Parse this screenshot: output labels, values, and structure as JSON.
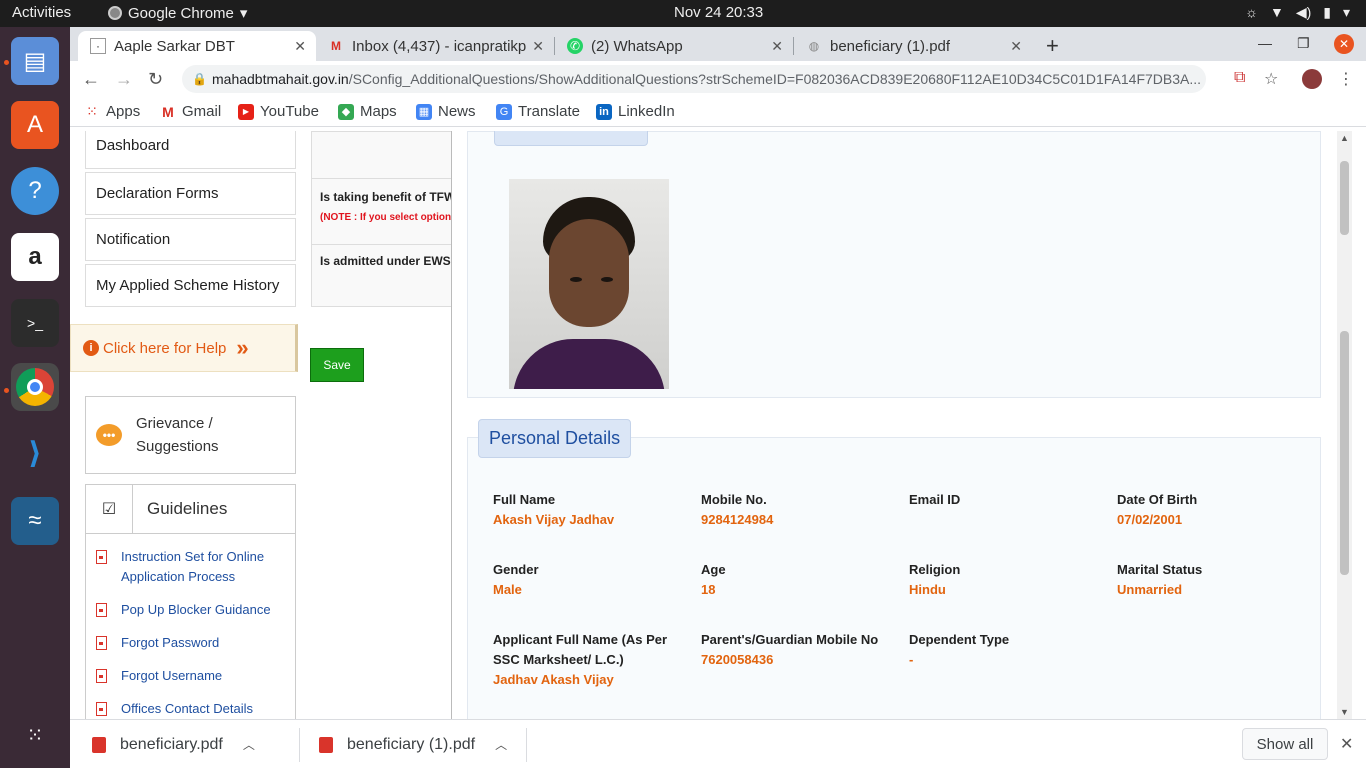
{
  "topbar": {
    "activities": "Activities",
    "app": "Google Chrome",
    "clock": "Nov 24  20:33"
  },
  "tabs": [
    {
      "title": "Aaple Sarkar DBT",
      "active": true
    },
    {
      "title": "Inbox (4,437) - icanpratikp",
      "active": false
    },
    {
      "title": "(2) WhatsApp",
      "active": false
    },
    {
      "title": "beneficiary (1).pdf",
      "active": false
    }
  ],
  "address": {
    "domain": "mahadbtmahait.gov.in",
    "path": "/SConfig_AdditionalQuestions/ShowAdditionalQuestions?strSchemeID=F082036ACD839E20680F112AE10D34C5C01D1FA14F7DB3A..."
  },
  "bookmarks": [
    {
      "label": "Apps",
      "icon": "apps-grid-icon"
    },
    {
      "label": "Gmail",
      "icon": "gmail-icon"
    },
    {
      "label": "YouTube",
      "icon": "youtube-icon"
    },
    {
      "label": "Maps",
      "icon": "maps-icon"
    },
    {
      "label": "News",
      "icon": "news-icon"
    },
    {
      "label": "Translate",
      "icon": "translate-icon"
    },
    {
      "label": "LinkedIn",
      "icon": "linkedin-icon"
    }
  ],
  "sidebar": {
    "items": [
      "Dashboard",
      "Declaration Forms",
      "Notification",
      "My Applied Scheme History"
    ],
    "help": "Click here for Help",
    "grievance": "Grievance / Suggestions",
    "guidelines_title": "Guidelines",
    "guidelines": [
      "Instruction Set for Online Application Process",
      "Pop Up Blocker Guidance",
      "Forgot Password",
      "Forgot Username",
      "Offices Contact Details"
    ]
  },
  "form": {
    "q1": "Is taking benefit of TFW",
    "note": "(NOTE : If you select option",
    "q2": "Is admitted under EWS",
    "save": "Save"
  },
  "modal": {
    "personal_title": "Personal Details",
    "fields": [
      {
        "label": "Full Name",
        "value": "Akash Vijay Jadhav"
      },
      {
        "label": "Mobile No.",
        "value": "9284124984"
      },
      {
        "label": "Email ID",
        "value": ""
      },
      {
        "label": "Date Of Birth",
        "value": "07/02/2001"
      },
      {
        "label": "Gender",
        "value": "Male"
      },
      {
        "label": "Age",
        "value": "18"
      },
      {
        "label": "Religion",
        "value": "Hindu"
      },
      {
        "label": "Marital Status",
        "value": "Unmarried"
      },
      {
        "label": "Applicant Full Name (As Per SSC Marksheet/ L.C.)",
        "value": "Jadhav Akash Vijay"
      },
      {
        "label": "Parent's/Guardian Mobile No",
        "value": "7620058436"
      },
      {
        "label": "Dependent Type",
        "value": "-"
      }
    ]
  },
  "downloads": {
    "items": [
      "beneficiary.pdf",
      "beneficiary (1).pdf"
    ],
    "show_all": "Show all"
  },
  "colors": {
    "accent_orange": "#e2640f",
    "link_blue": "#1f4fa0",
    "save_green": "#1d9f1d"
  }
}
